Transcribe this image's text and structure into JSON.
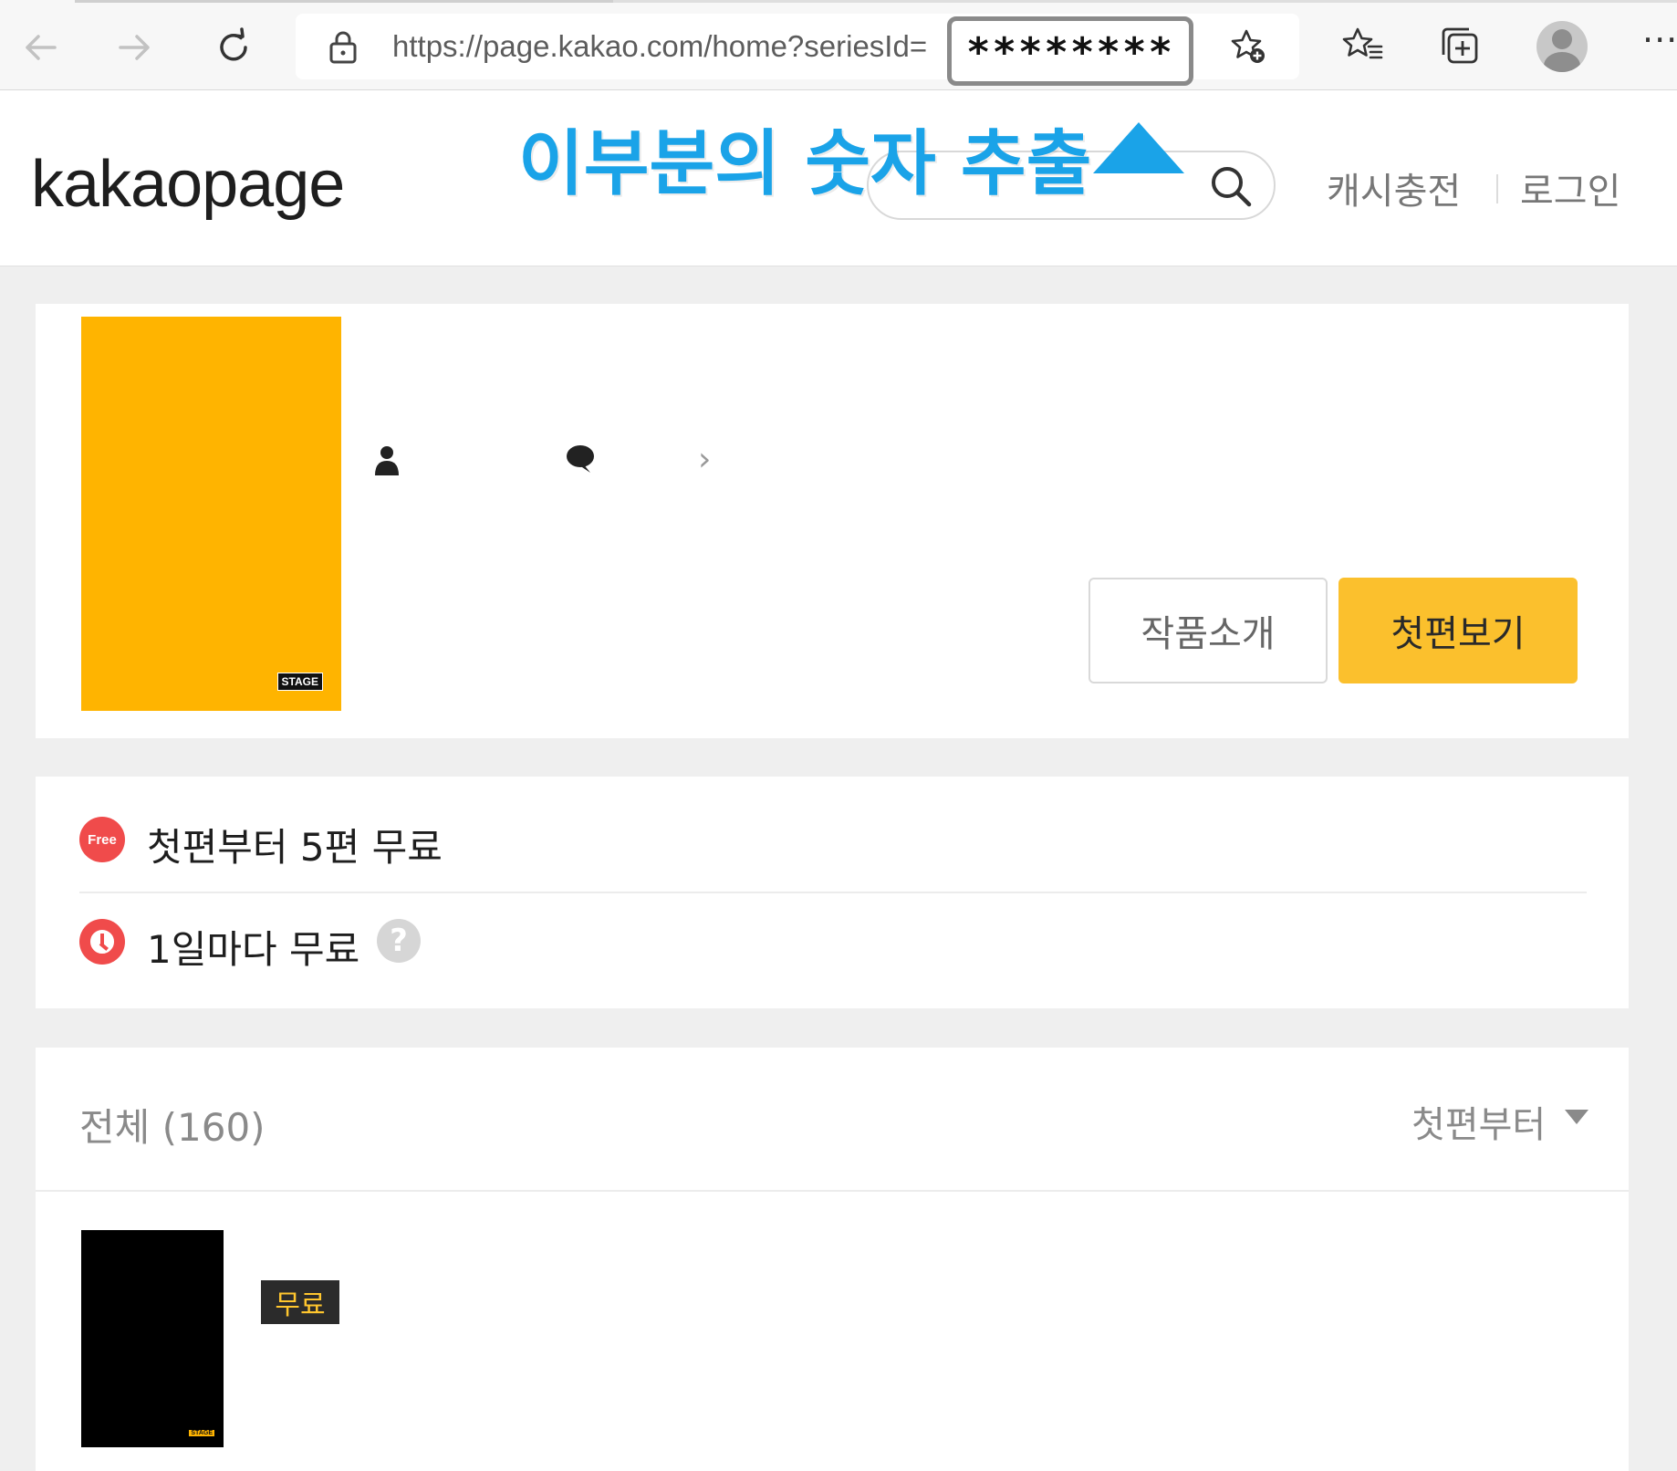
{
  "browser": {
    "url_prefix": "https://page.kakao.com/home?seriesId=",
    "url_masked_value": "********"
  },
  "header": {
    "logo": "kakaopage",
    "annotation": "이부분의 숫자 추출",
    "cash_charge": "캐시충전",
    "login": "로그인"
  },
  "series": {
    "stage_badge": "STAGE",
    "buttons": {
      "intro": "작품소개",
      "first_episode": "첫편보기"
    }
  },
  "promo": {
    "free_badge": "Free",
    "free_text": "첫편부터 5편 무료",
    "daily_text": "1일마다 무료",
    "help_glyph": "?"
  },
  "episode_list": {
    "total_label": "전체 (160)",
    "sort_label": "첫편부터",
    "items": [
      {
        "stage_badge": "STAGE",
        "free_tag": "무료"
      }
    ]
  },
  "colors": {
    "accent_yellow": "#fbc02d",
    "cover_orange": "#ffb400",
    "annotation_blue": "#1aa3e8",
    "badge_red": "#f04b4b"
  }
}
